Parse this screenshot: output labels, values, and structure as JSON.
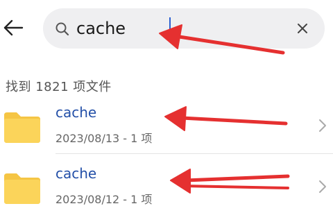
{
  "header": {
    "back_icon": "arrow-left-icon"
  },
  "search": {
    "value": "cache",
    "placeholder": "",
    "search_icon": "search-icon",
    "clear_icon": "close-icon"
  },
  "results": {
    "count_label": "找到 1821 项文件",
    "items": [
      {
        "name": "cache",
        "meta": "2023/08/13 - 1 项",
        "icon": "folder-icon"
      },
      {
        "name": "cache",
        "meta": "2023/08/12 - 1 项",
        "icon": "folder-icon"
      }
    ]
  },
  "annotation": {
    "arrow_color": "#e53030",
    "arrow_count": 4
  },
  "colors": {
    "accent": "#2450a8",
    "folder": "#f9cf4f",
    "search_background": "#efeff1",
    "caret": "#2a5fd1"
  }
}
